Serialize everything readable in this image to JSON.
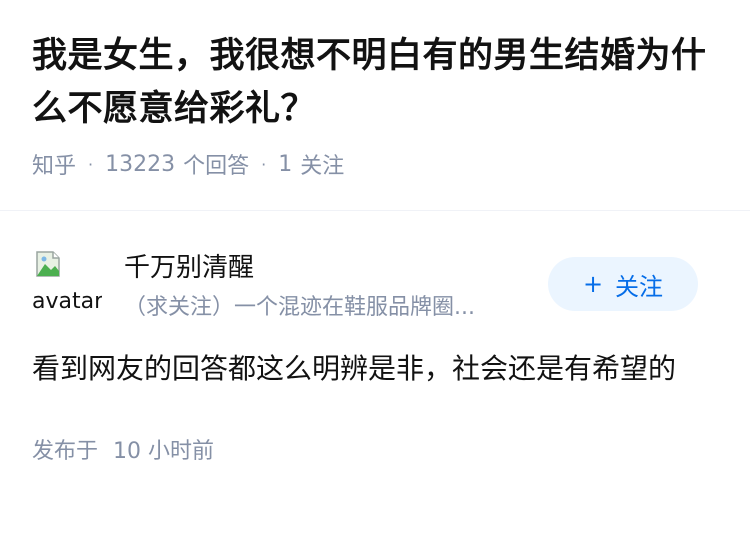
{
  "question": {
    "title": "我是女生，我很想不明白有的男生结婚为什么不愿意给彩礼？",
    "source": "知乎",
    "separator": "·",
    "answer_count": "13223",
    "answer_label": "个回答",
    "follow_count": "1",
    "follow_label": "关注"
  },
  "answer": {
    "author": {
      "avatar_alt": "avatar",
      "name": "千万别清醒",
      "bio": "（求关注）一个混迹在鞋服品牌圈..."
    },
    "follow_button": {
      "icon": "+",
      "label": "关注"
    },
    "content": "看到网友的回答都这么明辨是非，社会还是有希望的",
    "time_prefix": "发布于",
    "time_value": "10 小时前"
  },
  "colors": {
    "text": "#121212",
    "muted": "#8590a6",
    "accent": "#056de8",
    "accent_bg": "#ebf5ff"
  }
}
